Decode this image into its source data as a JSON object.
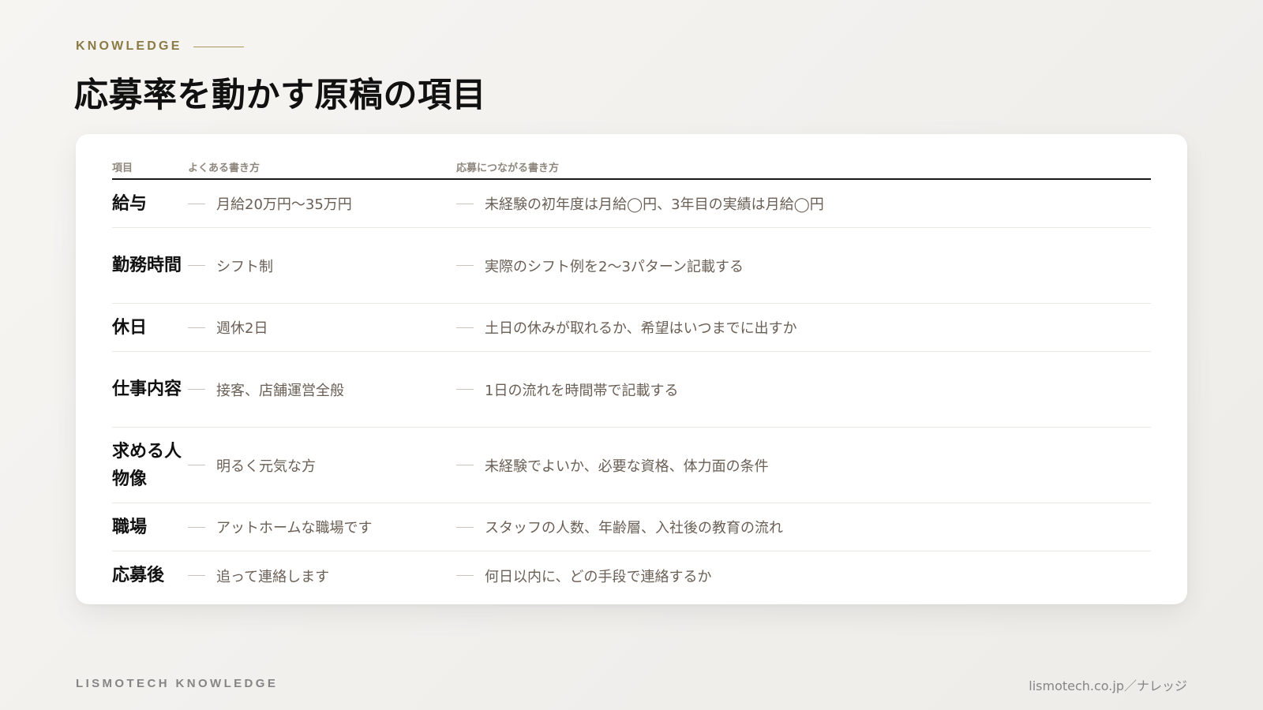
{
  "header": {
    "eyebrow": "KNOWLEDGE",
    "title": "応募率を動かす原稿の項目"
  },
  "table": {
    "columns": {
      "item": "項目",
      "common": "よくある書き方",
      "better": "応募につながる書き方"
    },
    "rows": [
      {
        "item": "給与",
        "common": "月給20万円〜35万円",
        "better": "未経験の初年度は月給◯円、3年目の実績は月給◯円"
      },
      {
        "item": "勤務時間",
        "common": "シフト制",
        "better": "実際のシフト例を2〜3パターン記載する"
      },
      {
        "item": "休日",
        "common": "週休2日",
        "better": "土日の休みが取れるか、希望はいつまでに出すか"
      },
      {
        "item": "仕事内容",
        "common": "接客、店舗運営全般",
        "better": "1日の流れを時間帯で記載する"
      },
      {
        "item": "求める人物像",
        "common": "明るく元気な方",
        "better": "未経験でよいか、必要な資格、体力面の条件"
      },
      {
        "item": "職場",
        "common": "アットホームな職場です",
        "better": "スタッフの人数、年齢層、入社後の教育の流れ"
      },
      {
        "item": "応募後",
        "common": "追って連絡します",
        "better": "何日以内に、どの手段で連絡するか"
      }
    ]
  },
  "footer": {
    "brand": "LISMOTECH KNOWLEDGE",
    "url": "lismotech.co.jp／ナレッジ"
  }
}
